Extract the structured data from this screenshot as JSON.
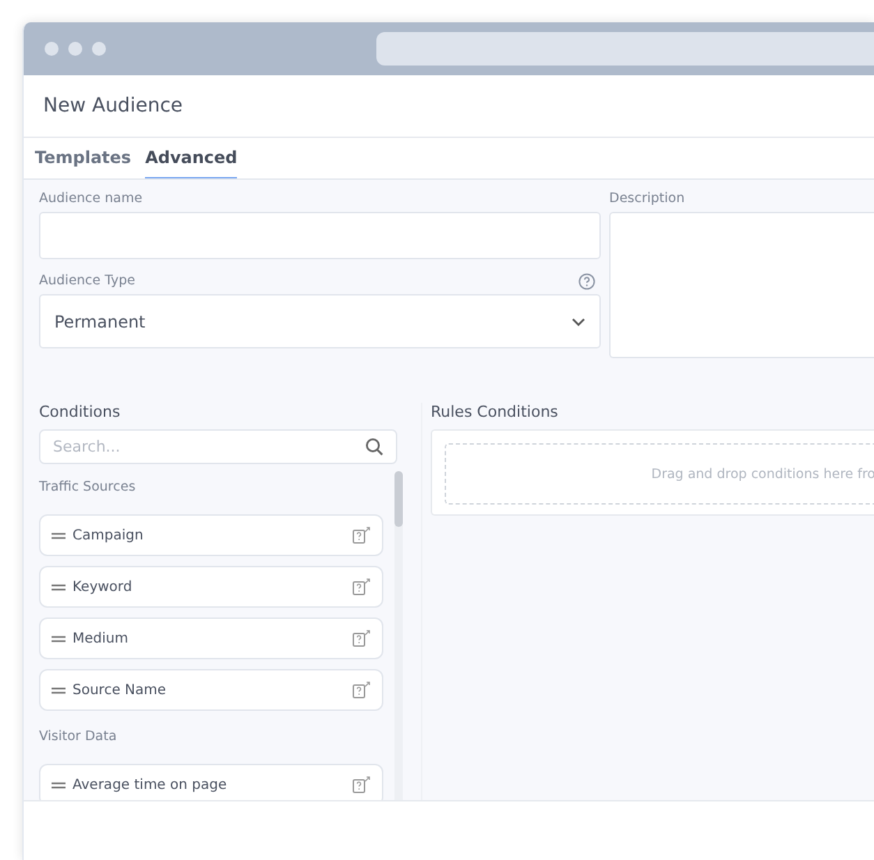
{
  "window": {
    "title": "New Audience"
  },
  "tabs": [
    {
      "label": "Templates",
      "selected": false
    },
    {
      "label": "Advanced",
      "selected": true
    }
  ],
  "form": {
    "audience_name": {
      "label": "Audience name"
    },
    "audience_type": {
      "label": "Audience Type",
      "value": "Permanent"
    },
    "description": {
      "label": "Description"
    }
  },
  "conditions": {
    "title": "Conditions",
    "search": {
      "placeholder": "Search..."
    },
    "groups": [
      {
        "title": "Traffic Sources",
        "items": [
          "Campaign",
          "Keyword",
          "Medium",
          "Source Name"
        ]
      },
      {
        "title": "Visitor Data",
        "items": [
          "Average time on page"
        ]
      }
    ]
  },
  "rules": {
    "title": "Rules Conditions",
    "drop_hint": "Drag and drop conditions here fro"
  }
}
